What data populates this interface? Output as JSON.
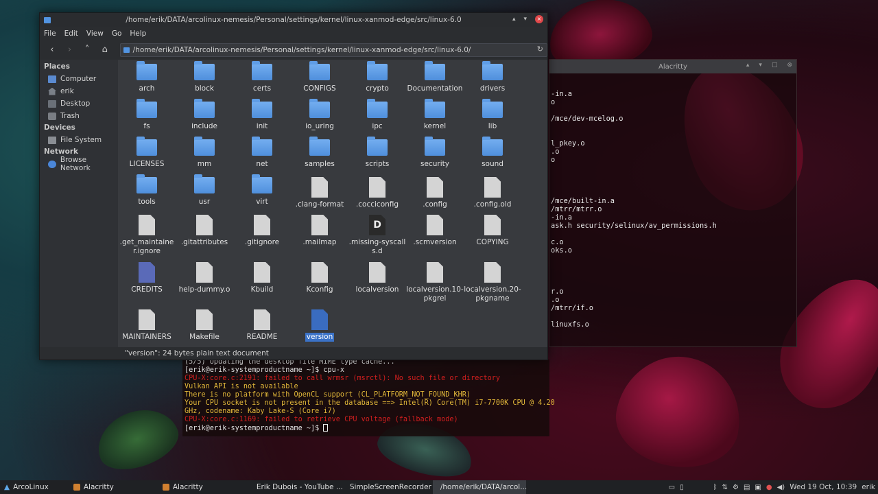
{
  "file_manager": {
    "title": "/home/erik/DATA/arcolinux-nemesis/Personal/settings/kernel/linux-xanmod-edge/src/linux-6.0",
    "menu": [
      "File",
      "Edit",
      "View",
      "Go",
      "Help"
    ],
    "path": "/home/erik/DATA/arcolinux-nemesis/Personal/settings/kernel/linux-xanmod-edge/src/linux-6.0/",
    "sidebar": {
      "places_label": "Places",
      "places": [
        "Computer",
        "erik",
        "Desktop",
        "Trash"
      ],
      "devices_label": "Devices",
      "devices": [
        "File System"
      ],
      "network_label": "Network",
      "network": [
        "Browse Network"
      ]
    },
    "items": [
      {
        "name": "arch",
        "kind": "folder"
      },
      {
        "name": "block",
        "kind": "folder"
      },
      {
        "name": "certs",
        "kind": "folder"
      },
      {
        "name": "CONFIGS",
        "kind": "folder"
      },
      {
        "name": "crypto",
        "kind": "folder"
      },
      {
        "name": "Documentation",
        "kind": "folder"
      },
      {
        "name": "drivers",
        "kind": "folder"
      },
      {
        "name": "fs",
        "kind": "folder"
      },
      {
        "name": "include",
        "kind": "folder"
      },
      {
        "name": "init",
        "kind": "folder"
      },
      {
        "name": "io_uring",
        "kind": "folder"
      },
      {
        "name": "ipc",
        "kind": "folder"
      },
      {
        "name": "kernel",
        "kind": "folder"
      },
      {
        "name": "lib",
        "kind": "folder"
      },
      {
        "name": "LICENSES",
        "kind": "folder"
      },
      {
        "name": "mm",
        "kind": "folder"
      },
      {
        "name": "net",
        "kind": "folder"
      },
      {
        "name": "samples",
        "kind": "folder"
      },
      {
        "name": "scripts",
        "kind": "folder"
      },
      {
        "name": "security",
        "kind": "folder"
      },
      {
        "name": "sound",
        "kind": "folder"
      },
      {
        "name": "tools",
        "kind": "folder"
      },
      {
        "name": "usr",
        "kind": "folder"
      },
      {
        "name": "virt",
        "kind": "folder"
      },
      {
        "name": ".clang-format",
        "kind": "doc"
      },
      {
        "name": ".cocciconfig",
        "kind": "doc"
      },
      {
        "name": ".config",
        "kind": "doc"
      },
      {
        "name": ".config.old",
        "kind": "doc"
      },
      {
        "name": ".get_maintainer.ignore",
        "kind": "doc"
      },
      {
        "name": ".gitattributes",
        "kind": "doc"
      },
      {
        "name": ".gitignore",
        "kind": "doc"
      },
      {
        "name": ".mailmap",
        "kind": "doc"
      },
      {
        "name": ".missing-syscalls.d",
        "kind": "dark",
        "glyph": "D"
      },
      {
        "name": ".scmversion",
        "kind": "doc"
      },
      {
        "name": "COPYING",
        "kind": "doc"
      },
      {
        "name": "CREDITS",
        "kind": "credits"
      },
      {
        "name": "help-dummy.o",
        "kind": "doc"
      },
      {
        "name": "Kbuild",
        "kind": "doc"
      },
      {
        "name": "Kconfig",
        "kind": "doc"
      },
      {
        "name": "localversion",
        "kind": "doc"
      },
      {
        "name": "localversion.10-pkgrel",
        "kind": "doc"
      },
      {
        "name": "localversion.20-pkgname",
        "kind": "doc"
      },
      {
        "name": "MAINTAINERS",
        "kind": "doc"
      },
      {
        "name": "Makefile",
        "kind": "doc"
      },
      {
        "name": "README",
        "kind": "doc"
      },
      {
        "name": "version",
        "kind": "selected"
      }
    ],
    "status": "\"version\": 24 bytes plain text document"
  },
  "alacritty_bg": {
    "title": "Alacritty",
    "lines": [
      "",
      "",
      "-in.a",
      "o",
      "",
      "/mce/dev-mcelog.o",
      "",
      "",
      "l_pkey.o",
      ".o",
      "o",
      "",
      "",
      "",
      "",
      "/mce/built-in.a",
      "/mtrr/mtrr.o",
      "-in.a",
      "ask.h security/selinux/av_permissions.h",
      "",
      "c.o",
      "oks.o",
      "",
      "",
      "",
      "",
      "r.o",
      ".o",
      "/mtrr/if.o",
      "",
      "linuxfs.o"
    ]
  },
  "terminal": {
    "line1": "(5/5) Updating the desktop file MIME type cache...",
    "prompt1": "[erik@erik-systemproductname ~]$ cpu-x",
    "err1": "CPU-X:core.c:2191: failed to call wrmsr (msrctl): No such file or directory",
    "warn1": "Vulkan API is not available",
    "warn2": "There is no platform with OpenCL support (CL_PLATFORM_NOT_FOUND_KHR)",
    "warn3": "Your CPU socket is not present in the database ==> Intel(R) Core(TM) i7-7700K CPU @ 4.20",
    "warn4": "GHz, codename: Kaby Lake-S (Core i7)",
    "err2": "CPU-X:core.c:1169: failed to retrieve CPU voltage (fallback mode)",
    "prompt2": "[erik@erik-systemproductname ~]$ "
  },
  "taskbar": {
    "items": [
      "ArcoLinux",
      "Alacritty",
      "Alacritty",
      "Erik Dubois - YouTube ...",
      "SimpleScreenRecorder",
      "/home/erik/DATA/arcol..."
    ],
    "clock": "Wed 19 Oct, 10:39",
    "user": "erik"
  }
}
